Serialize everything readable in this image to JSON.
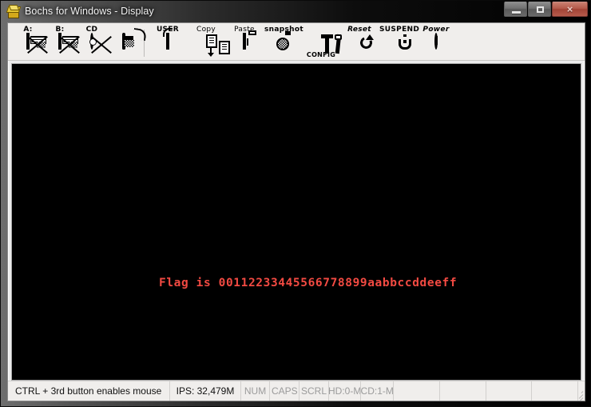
{
  "window": {
    "title": "Bochs for Windows - Display",
    "icon": "bochs-logo-icon",
    "controls": {
      "minimize": "–",
      "maximize": "☐",
      "close": "×"
    }
  },
  "toolbar": {
    "items": [
      {
        "label": "A:",
        "icon": "floppy-a-icon",
        "disabled": true
      },
      {
        "label": "B:",
        "icon": "floppy-b-icon",
        "disabled": true
      },
      {
        "label": "CD",
        "icon": "cdrom-icon",
        "disabled": true
      },
      {
        "label": "",
        "icon": "mouse-disabled-icon",
        "disabled": true
      },
      {
        "label": "USER",
        "icon": "keyboard-icon",
        "disabled": false
      },
      {
        "label": "Copy",
        "icon": "copy-icon",
        "disabled": false
      },
      {
        "label": "Paste",
        "icon": "paste-icon",
        "disabled": false
      },
      {
        "label": "snapshot",
        "icon": "camera-icon",
        "disabled": false
      },
      {
        "label": "CONFIG",
        "icon": "config-tools-icon",
        "disabled": false
      },
      {
        "label": "Reset",
        "icon": "reset-icon",
        "disabled": false
      },
      {
        "label": "SUSPEND",
        "icon": "suspend-icon",
        "disabled": false
      },
      {
        "label": "Power",
        "icon": "power-icon",
        "disabled": false
      }
    ]
  },
  "display": {
    "background_color": "#000000",
    "text_color": "#f24a42",
    "console_line": "Flag is 00112233445566778899aabbccddeeff"
  },
  "statusbar": {
    "message": "CTRL + 3rd button enables mouse",
    "ips": "IPS: 32,479M",
    "indicators": [
      "NUM",
      "CAPS",
      "SCRL"
    ],
    "drives": [
      "HD:0-M",
      "CD:1-M"
    ],
    "empty_panes": [
      "",
      "",
      "",
      "",
      ""
    ]
  }
}
